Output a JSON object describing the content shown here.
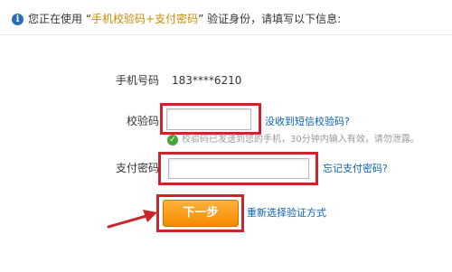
{
  "notice": {
    "prefix": "您正在使用 “",
    "method": "手机校验码+支付密码",
    "suffix": "” 验证身份，请填写以下信息:"
  },
  "form": {
    "phone_label": "手机号码",
    "phone_value": "183****6210",
    "code_label": "校验码",
    "code_value": "",
    "code_link": "没收到短信校验码?",
    "code_hint": "校验码已发送到您的手机，30分钟内输入有效，请勿泄露。",
    "pay_label": "支付密码",
    "pay_value": "",
    "pay_link": "忘记支付密码?",
    "next_button": "下一步",
    "reselect_link": "重新选择验证方式"
  },
  "colors": {
    "annotation_red": "#c8262b",
    "link_blue": "#0b62b5",
    "button_orange": "#f58a00",
    "highlight_gold": "#c98a00"
  }
}
